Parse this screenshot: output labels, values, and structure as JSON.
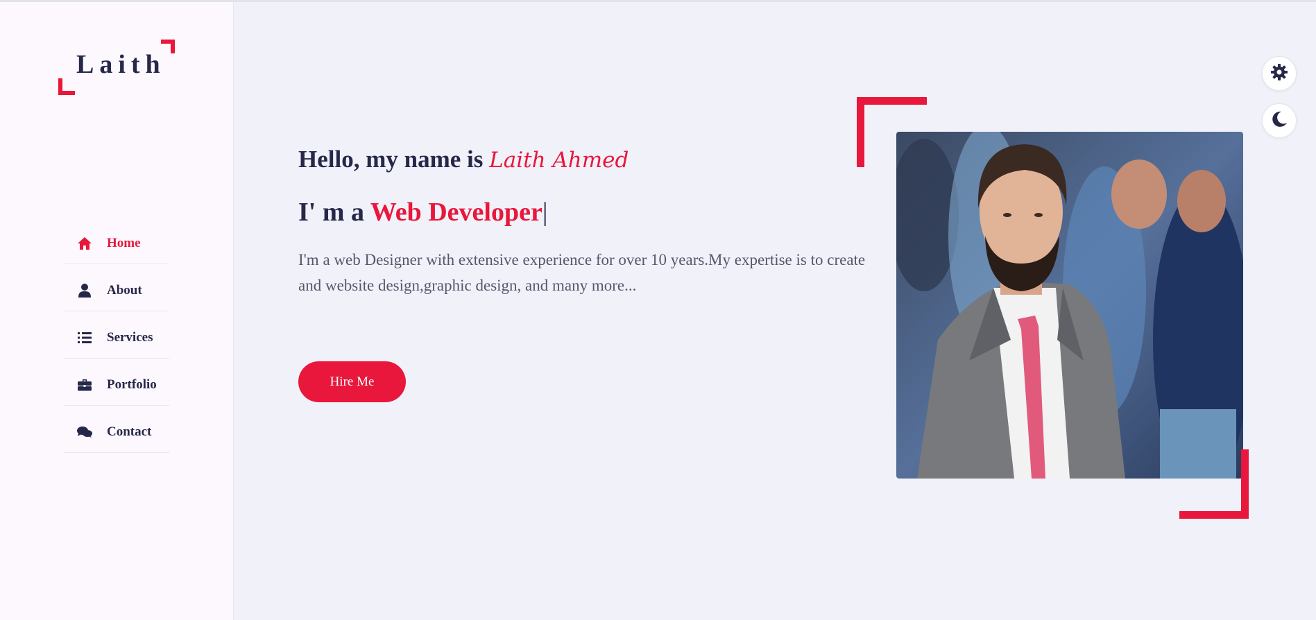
{
  "brand": {
    "logo_text": "Laith",
    "accent": "#e8173b",
    "dark": "#26284a"
  },
  "nav": {
    "items": [
      {
        "label": "Home",
        "icon": "home-icon",
        "active": true
      },
      {
        "label": "About",
        "icon": "user-icon",
        "active": false
      },
      {
        "label": "Services",
        "icon": "list-icon",
        "active": false
      },
      {
        "label": "Portfolio",
        "icon": "briefcase-icon",
        "active": false
      },
      {
        "label": "Contact",
        "icon": "comments-icon",
        "active": false
      }
    ]
  },
  "hero": {
    "greeting_prefix": "Hello, my name is",
    "name": "Laith Ahmed",
    "role_prefix": "I' m a",
    "role_highlight": "Web Developer",
    "cursor": "|",
    "description": "I'm a web Designer with extensive experience for over 10 years.My expertise is to create and website design,graphic design, and many more...",
    "cta_label": "Hire Me"
  },
  "controls": {
    "settings_icon": "gear-icon",
    "theme_icon": "moon-icon"
  }
}
